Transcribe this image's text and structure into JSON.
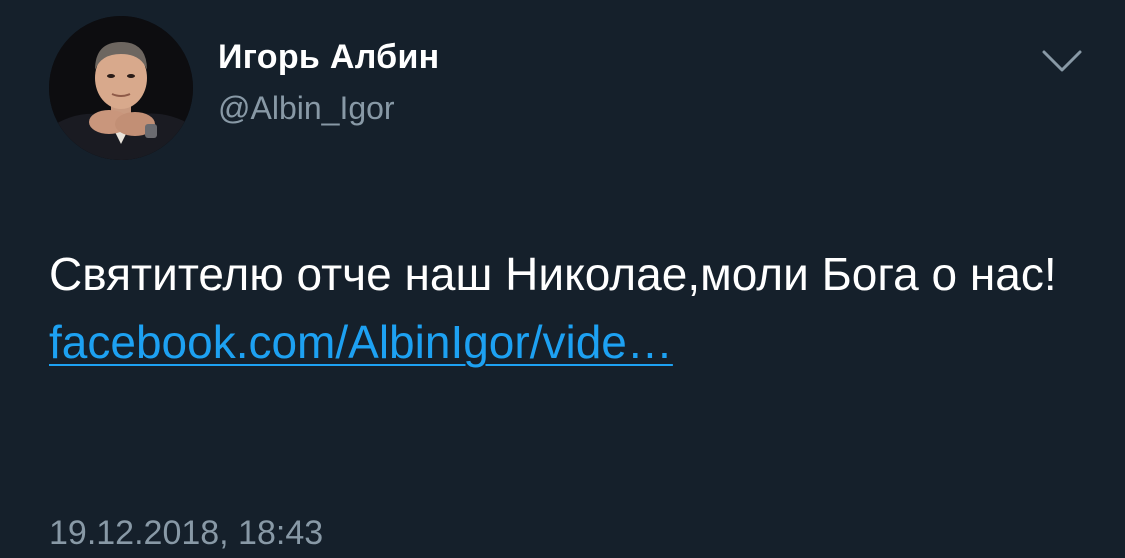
{
  "author": {
    "display_name": "Игорь Албин",
    "handle": "@Albin_Igor",
    "avatar_icon": "profile-photo"
  },
  "menu": {
    "icon": "chevron-down-icon"
  },
  "tweet": {
    "text_line": "Святителю отче наш Николае,моли Бога о нас!",
    "link_text": "facebook.com/AlbinIgor/vide…",
    "timestamp": "19.12.2018, 18:43"
  },
  "colors": {
    "background": "#15202b",
    "text": "#ffffff",
    "secondary_text": "#8899a6",
    "link": "#1da1f2"
  }
}
